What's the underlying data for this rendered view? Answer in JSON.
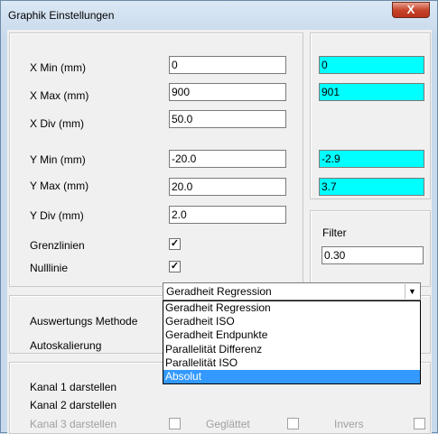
{
  "window": {
    "title": "Graphik Einstellungen",
    "close_label": "X"
  },
  "axes": {
    "x_min": {
      "label": "X Min  (mm)",
      "value": "0",
      "result": "0"
    },
    "x_max": {
      "label": "X Max  (mm)",
      "value": "900",
      "result": "901"
    },
    "x_div": {
      "label": "X Div  (mm)",
      "value": "50.0"
    },
    "y_min": {
      "label": "Y Min  (mm)",
      "value": "-20.0",
      "result": "-2.9"
    },
    "y_max": {
      "label": "Y Max  (mm)",
      "value": "20.0",
      "result": "3.7"
    },
    "y_div": {
      "label": "Y Div  (mm)",
      "value": "2.0"
    }
  },
  "options": {
    "grenzlinien": {
      "label": "Grenzlinien",
      "checked": true
    },
    "nulllinie": {
      "label": "Nulllinie",
      "checked": true
    }
  },
  "filter": {
    "label": "Filter",
    "value": "0.30"
  },
  "evaluation": {
    "method_label": "Auswertungs Methode",
    "method_value": "Geradheit Regression",
    "autoscale_label": "Autoskalierung",
    "method_options": [
      "Geradheit Regression",
      "Geradheit ISO",
      "Geradheit Endpunkte",
      "Parallelität Differenz",
      "Parallelität ISO",
      "Absolut"
    ],
    "highlighted_option": "Absolut"
  },
  "channels": {
    "kanal1_label": "Kanal 1 darstellen",
    "kanal2_label": "Kanal 2 darstellen",
    "kanal3_label": "Kanal 3 darstellen",
    "geglaettet_label": "Geglättet",
    "invers_label": "Invers"
  },
  "check_glyph": "✓"
}
